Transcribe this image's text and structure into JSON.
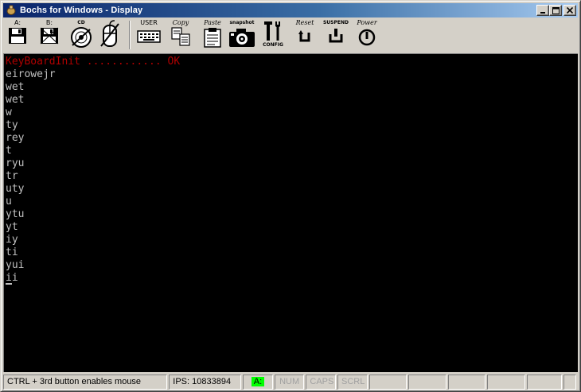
{
  "window": {
    "title": "Bochs for Windows - Display",
    "controls": [
      "minimize",
      "maximize",
      "close"
    ]
  },
  "toolbar": {
    "floppy_a_label": "A:",
    "floppy_b_label": "B:",
    "cd_label": "CD",
    "user_label": "USER",
    "copy_label": "Copy",
    "paste_label": "Paste",
    "snapshot_label": "snapshot",
    "config_label": "CONFIG",
    "reset_label": "Reset",
    "suspend_label": "SUSPEND",
    "power_label": "Power"
  },
  "console": {
    "lines": [
      "KeyBoardInit ............ OK",
      "eirowejr",
      "wet",
      "wet",
      "w",
      "ty",
      "rey",
      "t",
      "ryu",
      "tr",
      "uty",
      "u",
      "ytu",
      "yt",
      "iy",
      "ti",
      "yui",
      "ii"
    ],
    "colors": {
      "status_line": "#b00000",
      "text": "#c0c0c0",
      "background": "#000000"
    }
  },
  "statusbar": {
    "hint": "CTRL + 3rd button enables mouse",
    "ips": "IPS:  10833894",
    "drive_led": "A:",
    "num": "NUM",
    "caps": "CAPS",
    "scrl": "SCRL",
    "led_color": "#00ff00"
  }
}
